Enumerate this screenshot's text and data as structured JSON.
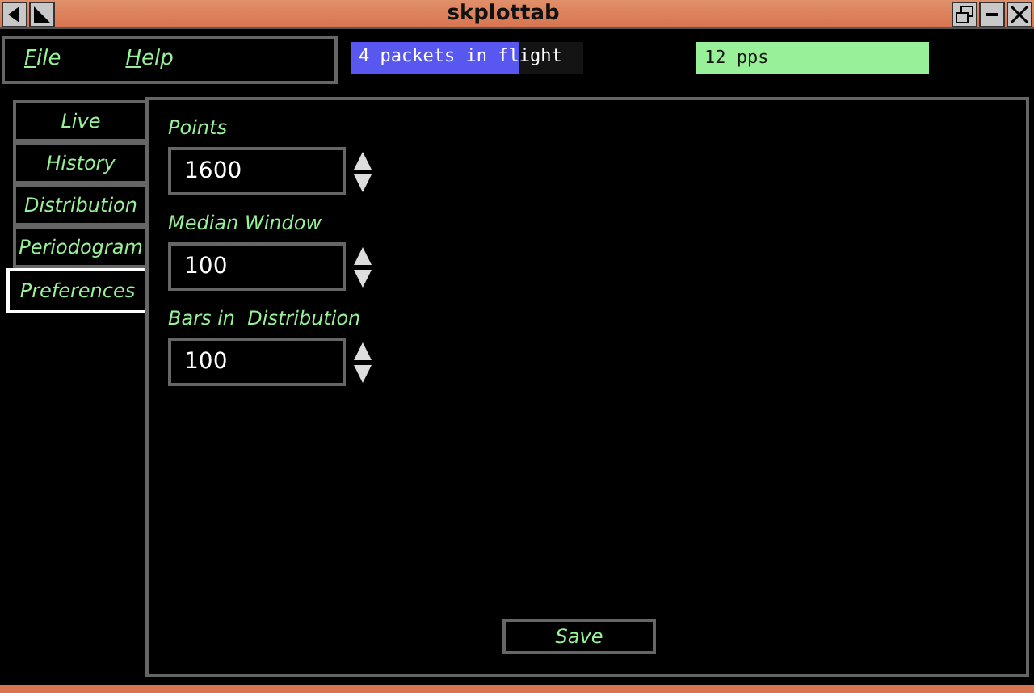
{
  "window": {
    "title": "skplottab"
  },
  "menu": [
    {
      "mnemonic": "F",
      "rest": "ile"
    },
    {
      "mnemonic": "H",
      "rest": "elp"
    }
  ],
  "flight": {
    "text": "4 packets in flight",
    "level": 0.72
  },
  "rate": {
    "text": "12 pps"
  },
  "tabs": [
    {
      "label": "Live",
      "selected": false
    },
    {
      "label": "History",
      "selected": false
    },
    {
      "label": "Distribution",
      "selected": false
    },
    {
      "label": "Periodogram",
      "selected": false
    },
    {
      "label": "Preferences",
      "selected": true
    }
  ],
  "fields": [
    {
      "label": "Points",
      "value": "1600"
    },
    {
      "label": "Median Window",
      "value": "100"
    },
    {
      "label": "Bars in  Distribution",
      "value": "100"
    }
  ],
  "save": "Save"
}
